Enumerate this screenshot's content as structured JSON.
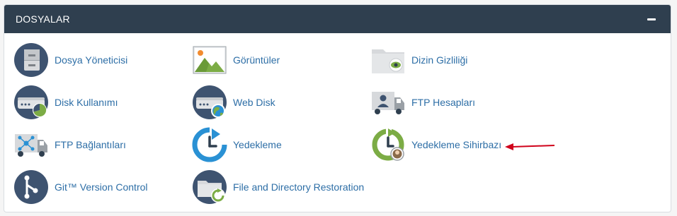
{
  "panel": {
    "title": "DOSYALAR",
    "collapse_label": "collapse-minus"
  },
  "items": [
    {
      "label": "Dosya Yöneticisi",
      "icon": "file-manager-icon"
    },
    {
      "label": "Görüntüler",
      "icon": "images-icon"
    },
    {
      "label": "Dizin Gizliliği",
      "icon": "directory-privacy-icon"
    },
    {
      "label": "Disk Kullanımı",
      "icon": "disk-usage-icon"
    },
    {
      "label": "Web Disk",
      "icon": "web-disk-icon"
    },
    {
      "label": "FTP Hesapları",
      "icon": "ftp-accounts-icon"
    },
    {
      "label": "FTP Bağlantıları",
      "icon": "ftp-connections-icon"
    },
    {
      "label": "Yedekleme",
      "icon": "backup-icon"
    },
    {
      "label": "Yedekleme Sihirbazı",
      "icon": "backup-wizard-icon"
    },
    {
      "label": "Git™ Version Control",
      "icon": "git-icon"
    },
    {
      "label": "File and Directory Restoration",
      "icon": "file-restoration-icon"
    }
  ],
  "colors": {
    "header_bg": "#2f3f4f",
    "link": "#2d6ea6",
    "icon_navy": "#3e5370",
    "icon_blue": "#2a91d4",
    "icon_green": "#7cac45",
    "annotation_arrow": "#d0021b"
  }
}
